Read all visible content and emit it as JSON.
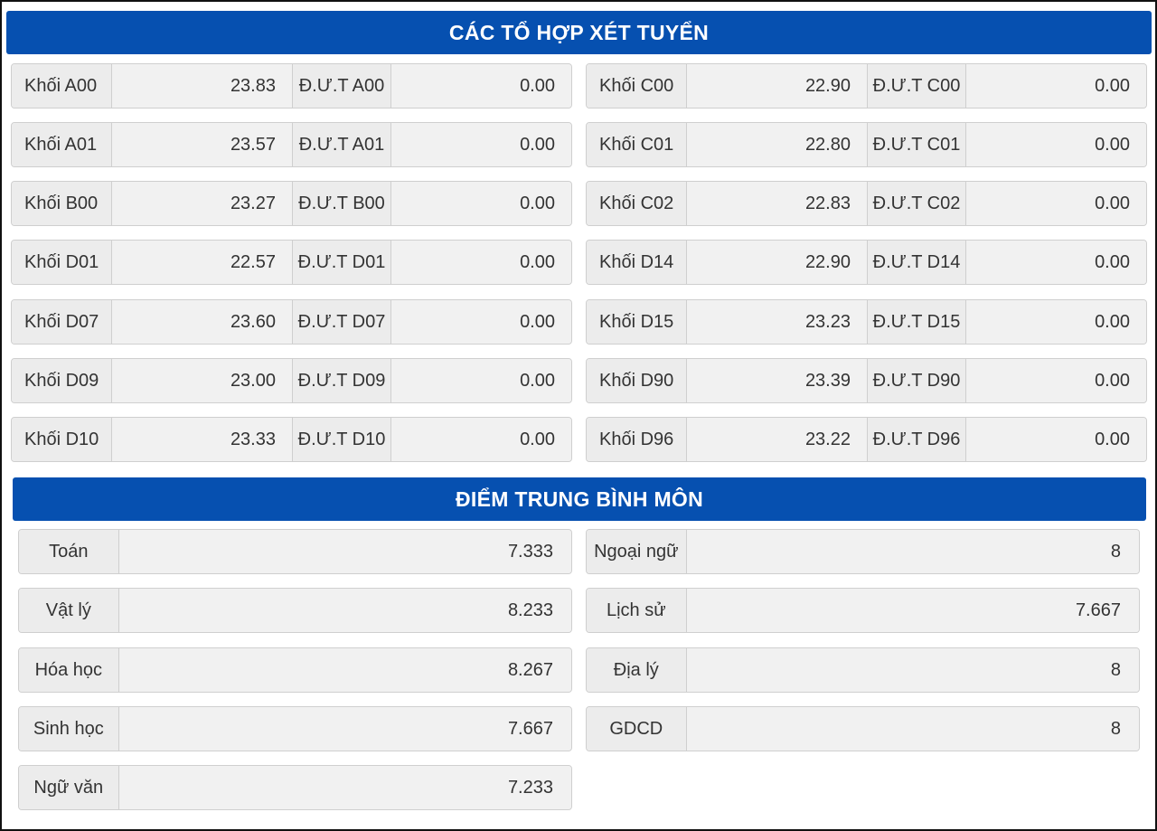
{
  "combo_title": "CÁC TỔ HỢP XÉT TUYỂN",
  "subject_title": "ĐIỂM TRUNG BÌNH MÔN",
  "combos_left": [
    {
      "label": "Khối A00",
      "value": "23.83",
      "dut_label": "Đ.Ư.T A00",
      "dut_value": "0.00"
    },
    {
      "label": "Khối A01",
      "value": "23.57",
      "dut_label": "Đ.Ư.T A01",
      "dut_value": "0.00"
    },
    {
      "label": "Khối B00",
      "value": "23.27",
      "dut_label": "Đ.Ư.T B00",
      "dut_value": "0.00"
    },
    {
      "label": "Khối D01",
      "value": "22.57",
      "dut_label": "Đ.Ư.T D01",
      "dut_value": "0.00"
    },
    {
      "label": "Khối D07",
      "value": "23.60",
      "dut_label": "Đ.Ư.T D07",
      "dut_value": "0.00"
    },
    {
      "label": "Khối D09",
      "value": "23.00",
      "dut_label": "Đ.Ư.T D09",
      "dut_value": "0.00"
    },
    {
      "label": "Khối D10",
      "value": "23.33",
      "dut_label": "Đ.Ư.T D10",
      "dut_value": "0.00"
    }
  ],
  "combos_right": [
    {
      "label": "Khối C00",
      "value": "22.90",
      "dut_label": "Đ.Ư.T C00",
      "dut_value": "0.00"
    },
    {
      "label": "Khối C01",
      "value": "22.80",
      "dut_label": "Đ.Ư.T C01",
      "dut_value": "0.00"
    },
    {
      "label": "Khối C02",
      "value": "22.83",
      "dut_label": "Đ.Ư.T C02",
      "dut_value": "0.00"
    },
    {
      "label": "Khối D14",
      "value": "22.90",
      "dut_label": "Đ.Ư.T D14",
      "dut_value": "0.00"
    },
    {
      "label": "Khối D15",
      "value": "23.23",
      "dut_label": "Đ.Ư.T D15",
      "dut_value": "0.00"
    },
    {
      "label": "Khối D90",
      "value": "23.39",
      "dut_label": "Đ.Ư.T D90",
      "dut_value": "0.00"
    },
    {
      "label": "Khối D96",
      "value": "23.22",
      "dut_label": "Đ.Ư.T D96",
      "dut_value": "0.00"
    }
  ],
  "subjects_left": [
    {
      "label": "Toán",
      "value": "7.333"
    },
    {
      "label": "Vật lý",
      "value": "8.233"
    },
    {
      "label": "Hóa học",
      "value": "8.267"
    },
    {
      "label": "Sinh học",
      "value": "7.667"
    },
    {
      "label": "Ngữ văn",
      "value": "7.233"
    }
  ],
  "subjects_right": [
    {
      "label": "Ngoại ngữ",
      "value": "8"
    },
    {
      "label": "Lịch sử",
      "value": "7.667"
    },
    {
      "label": "Địa lý",
      "value": "8"
    },
    {
      "label": "GDCD",
      "value": "8"
    }
  ]
}
